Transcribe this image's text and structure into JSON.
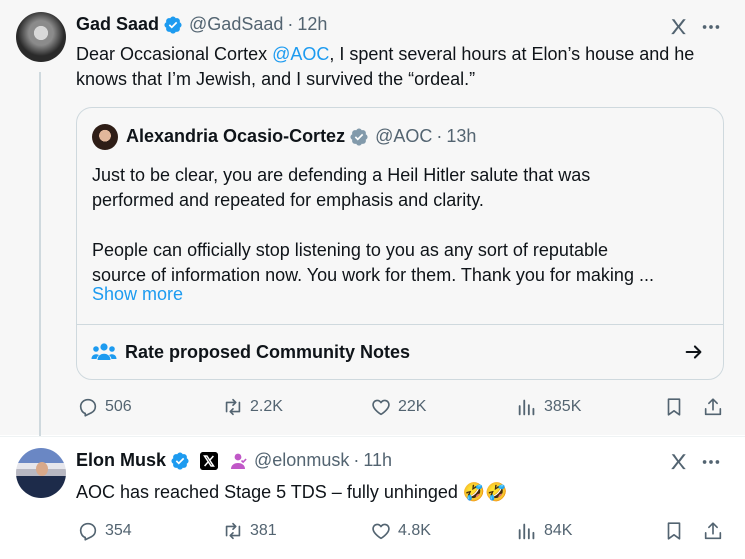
{
  "tweet1": {
    "name": "Gad Saad",
    "handle": "@GadSaad",
    "time": "12h",
    "text_before": "Dear Occasional Cortex ",
    "mention": "@AOC",
    "text_after_line1": ", I spent several hours at Elon’s house and he",
    "text_line2": "knows that I’m Jewish, and I survived the “ordeal.”",
    "stats": {
      "replies": "506",
      "reposts": "2.2K",
      "likes": "22K",
      "views": "385K"
    }
  },
  "quote": {
    "name": "Alexandria Ocasio-Cortez",
    "handle": "@AOC",
    "time": "13h",
    "line1": "Just to be clear, you are defending a Heil Hitler salute that was",
    "line2": "performed and repeated for emphasis and clarity.",
    "line3": "People can officially stop listening to you as any sort of reputable",
    "line4": "source of information now. You work for them. Thank you for making ...",
    "show_more": "Show more",
    "community_notes": "Rate proposed Community Notes"
  },
  "tweet2": {
    "name": "Elon Musk",
    "handle": "@elonmusk",
    "time": "11h",
    "text": "AOC has reached Stage 5 TDS – fully unhinged 🤣🤣",
    "stats": {
      "replies": "354",
      "reposts": "381",
      "likes": "4.8K",
      "views": "84K"
    }
  },
  "colors": {
    "accent": "#1d9bf0",
    "secondary_text": "#536471",
    "verified": "#1d9bf0",
    "gov_badge": "#829aab"
  }
}
